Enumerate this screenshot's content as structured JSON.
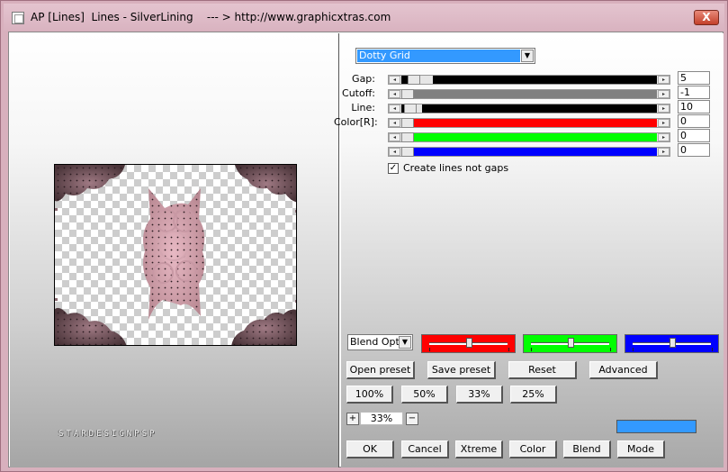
{
  "window": {
    "title": "AP [Lines]  Lines - SilverLining    --- > http://www.graphicxtras.com",
    "close_label": "X"
  },
  "preview": {
    "watermark": "STARDESIGNPSP"
  },
  "style_dropdown": {
    "value": "Dotty Grid"
  },
  "params": [
    {
      "label": "Gap:",
      "value": "5",
      "track_color": "#000000",
      "fill_fraction": 0.025
    },
    {
      "label": "Cutoff:",
      "value": "-1",
      "track_color": "#808080",
      "fill_fraction": 0.0
    },
    {
      "label": "Line:",
      "value": "10",
      "track_color": "#000000",
      "fill_fraction": 0.01
    },
    {
      "label": "Color[R]:",
      "value": "0",
      "track_color": "#ff0000",
      "fill_fraction": 0.0
    },
    {
      "label": "",
      "value": "0",
      "track_color": "#00ff00",
      "fill_fraction": 0.0
    },
    {
      "label": "",
      "value": "0",
      "track_color": "#0000ff",
      "fill_fraction": 0.0
    }
  ],
  "create_lines": {
    "label": "Create lines not gaps",
    "checked": true,
    "mark": "✓"
  },
  "blend_dropdown": {
    "value": "Blend Optio"
  },
  "color_sliders": [
    {
      "color": "#ff0000",
      "fraction": 0.5
    },
    {
      "color": "#00ff00",
      "fraction": 0.5
    },
    {
      "color": "#0000ff",
      "fraction": 0.5
    }
  ],
  "buttons": {
    "open_preset": "Open preset",
    "save_preset": "Save preset",
    "reset": "Reset",
    "advanced": "Advanced",
    "zoom_100": "100%",
    "zoom_50": "50%",
    "zoom_33": "33%",
    "zoom_25": "25%",
    "plus": "+",
    "minus": "−",
    "ok": "OK",
    "cancel": "Cancel",
    "xtreme": "Xtreme",
    "color": "Color",
    "blend": "Blend",
    "mode": "Mode"
  },
  "zoom": {
    "value": "33%"
  },
  "swatch_color": "#3399ff",
  "icons": {
    "arrow_left": "◂",
    "arrow_right": "▸",
    "dropdown": "▼"
  }
}
